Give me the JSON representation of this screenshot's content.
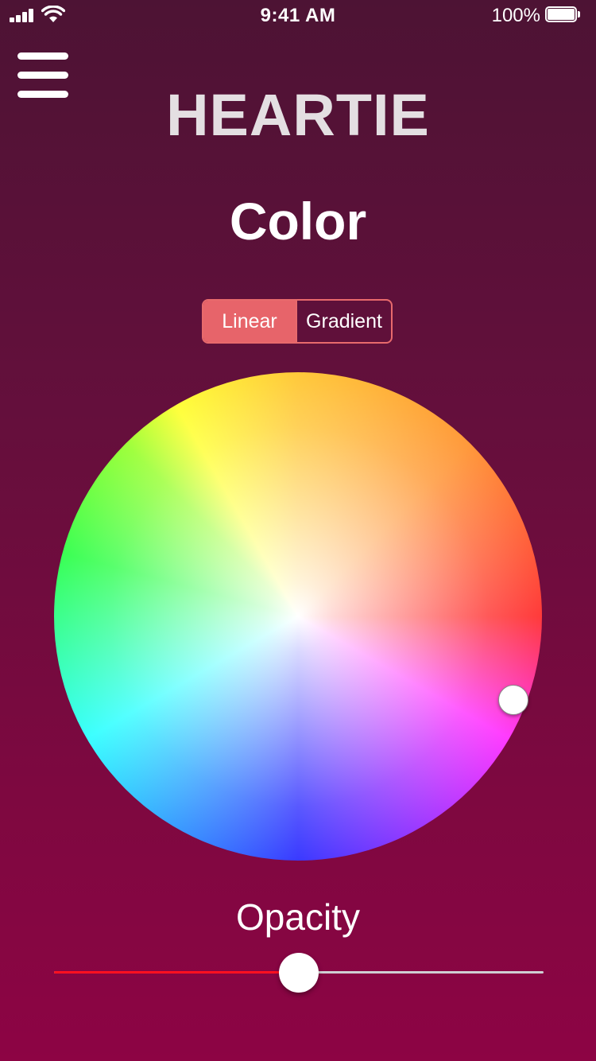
{
  "status_bar": {
    "time": "9:41 AM",
    "battery_percent": "100%",
    "signal_icon": "cellular-signal-icon",
    "wifi_icon": "wifi-icon",
    "battery_icon": "battery-icon",
    "battery_level": 1.0
  },
  "header": {
    "menu_icon": "hamburger-menu-icon",
    "app_title": "HEARTIE"
  },
  "page": {
    "title": "Color"
  },
  "mode_toggle": {
    "options": [
      "Linear",
      "Gradient"
    ],
    "selected": "Linear",
    "accent_color": "#e7646a"
  },
  "color_wheel": {
    "selected_color": "#ff2ee6"
  },
  "opacity": {
    "label": "Opacity",
    "value": 0.5,
    "fill_color": "#ff1020"
  }
}
